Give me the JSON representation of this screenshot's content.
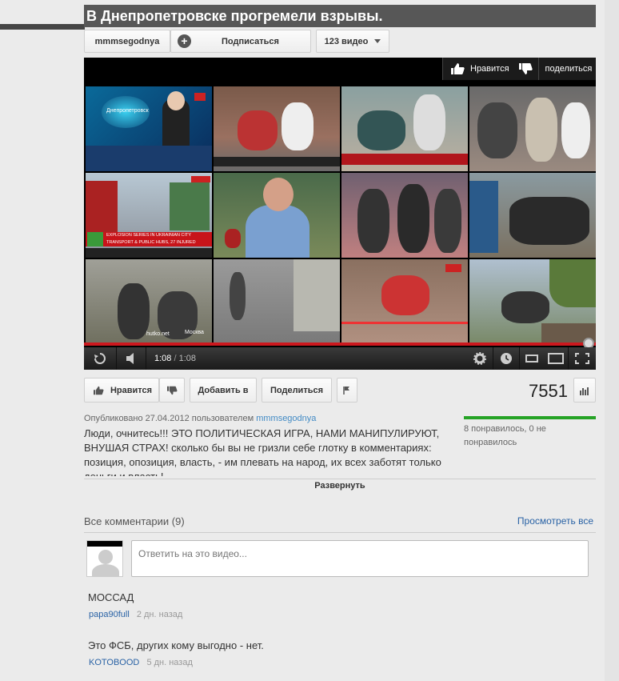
{
  "video": {
    "title": "В Днепропетровске прогремели взрывы.",
    "channel": "mmmsegodnya",
    "subscribe_label": "Подписаться",
    "videos_count_label": "123 видео",
    "player": {
      "like_label": "Нравится",
      "share_label": "поделиться",
      "time_current": "1:08",
      "time_separator": " / ",
      "time_total": "1:08",
      "progress_fraction": 1.0
    }
  },
  "actions": {
    "like_label": "Нравится",
    "addto_label": "Добавить в",
    "share_label": "Поделиться",
    "views": "7551"
  },
  "details": {
    "published_prefix": "Опубликовано 27.04.2012 пользователем",
    "published_user": "mmmsegodnya",
    "likes_summary": "8 понравилось, 0 не понравилось",
    "description": "Люди, очнитесь!!! ЭТО ПОЛИТИЧЕСКАЯ ИГРА, НАМИ МАНИПУЛИРУЮТ, ВНУШАЯ СТРАХ! сколько бы вы не гризли себе глотку в комментариях: позиция, опозиция, власть, - им плевать на народ, их всех заботят только деньги и власть!",
    "expand_label": "Развернуть"
  },
  "comments": {
    "header": "Все комментарии (9)",
    "view_all_label": "Просмотреть все",
    "reply_placeholder": "Ответить на это видео...",
    "items": [
      {
        "text": "МОССАД",
        "user": "papa90full",
        "time": "2 дн. назад"
      },
      {
        "text": "Это ФСБ, других кому выгодно - нет.",
        "user": "KOTOBOOD",
        "time": "5 дн. назад"
      }
    ]
  },
  "thumb_texts": {
    "t1_logo": "Днепропетровск",
    "t5_banner": "EXPLOSION SERIES IN UKRAINIAN CITY",
    "t5_banner2": "TRANSPORT & PUBLIC HUBS, 27 INJURED",
    "t9_credit": "hutko.net",
    "t10_credit": "Москва"
  },
  "colors": {
    "title_bg": "#575757",
    "progress": "#cc181e",
    "like_bar": "#26a326",
    "link": "#2962a5"
  }
}
